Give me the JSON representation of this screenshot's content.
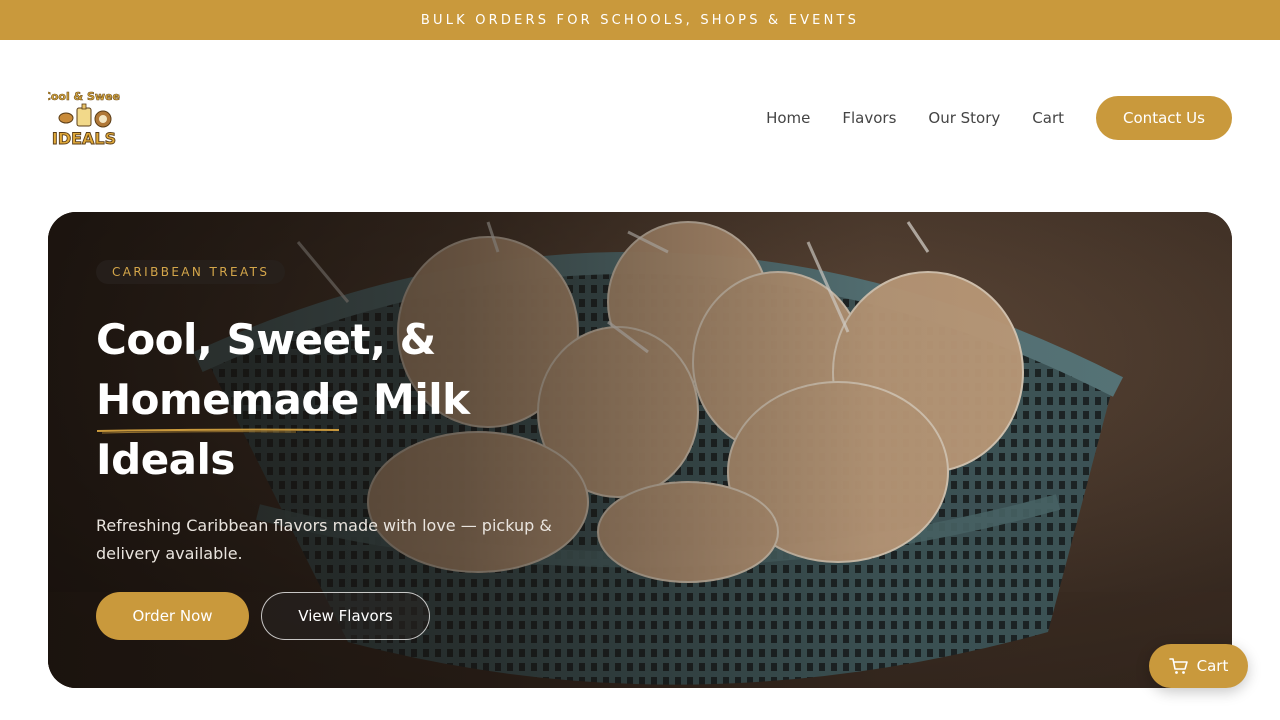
{
  "banner": {
    "text": "BULK ORDERS FOR SCHOOLS, SHOPS & EVENTS"
  },
  "logo": {
    "line1": "Cool & Sweet",
    "line2": "IDEALS"
  },
  "nav": {
    "items": [
      {
        "label": "Home"
      },
      {
        "label": "Flavors"
      },
      {
        "label": "Our Story"
      },
      {
        "label": "Cart"
      }
    ],
    "contact_label": "Contact Us"
  },
  "hero": {
    "eyebrow": "CARIBBEAN TREATS",
    "title_line1": "Cool, Sweet, &",
    "title_line2": "Homemade Milk",
    "title_line3": "Ideals",
    "subtitle": "Refreshing Caribbean flavors made with love — pickup & delivery available.",
    "order_label": "Order Now",
    "flavors_label": "View Flavors"
  },
  "float_cart": {
    "label": "Cart",
    "icon": "cart-icon"
  },
  "colors": {
    "accent": "#c9993c",
    "banner_bg": "#c9993c",
    "eyebrow_text": "#d4a64a"
  }
}
